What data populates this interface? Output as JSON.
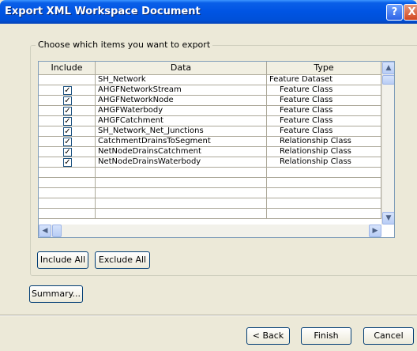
{
  "window": {
    "title": "Export XML Workspace Document",
    "help_glyph": "?",
    "close_glyph": "X"
  },
  "group": {
    "label": "Choose which items you want to export"
  },
  "grid": {
    "columns": [
      "Include",
      "Data",
      "Type"
    ],
    "rows": [
      {
        "include": null,
        "data": "SH_Network",
        "type": "Feature Dataset"
      },
      {
        "include": true,
        "data": "AHGFNetworkStream",
        "type": "Feature Class"
      },
      {
        "include": true,
        "data": "AHGFNetworkNode",
        "type": "Feature Class"
      },
      {
        "include": true,
        "data": "AHGFWaterbody",
        "type": "Feature Class"
      },
      {
        "include": true,
        "data": "AHGFCatchment",
        "type": "Feature Class"
      },
      {
        "include": true,
        "data": "SH_Network_Net_Junctions",
        "type": "Feature Class"
      },
      {
        "include": true,
        "data": "CatchmentDrainsToSegment",
        "type": "Relationship Class"
      },
      {
        "include": true,
        "data": "NetNodeDrainsCatchment",
        "type": "Relationship Class"
      },
      {
        "include": true,
        "data": "NetNodeDrainsWaterbody",
        "type": "Relationship Class"
      }
    ]
  },
  "buttons": {
    "include_all": "Include All",
    "exclude_all": "Exclude All",
    "summary": "Summary...",
    "back": "< Back",
    "finish": "Finish",
    "cancel": "Cancel"
  },
  "colors": {
    "titlebar": "#0054e3",
    "dialog_bg": "#ece9d8",
    "header_bg": "#f1efe2"
  }
}
